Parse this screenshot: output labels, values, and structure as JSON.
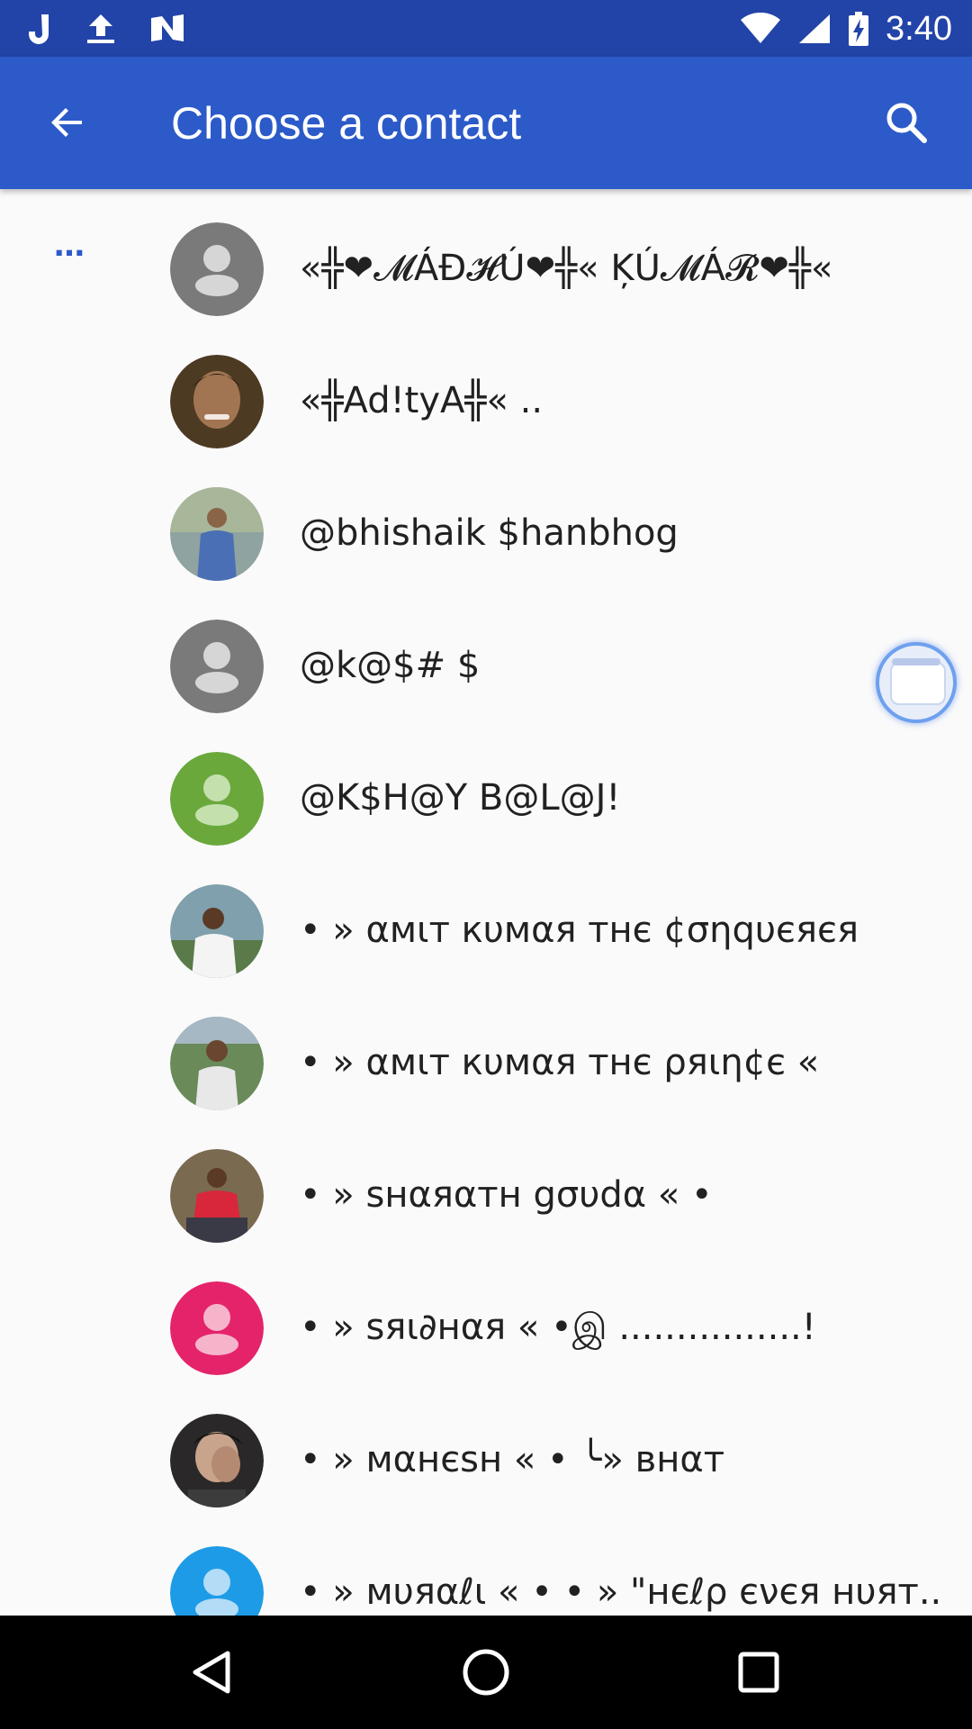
{
  "status_bar": {
    "time": "3:40",
    "left_icons": [
      "j-app-icon",
      "upload-icon",
      "n-app-icon"
    ],
    "right_icons": [
      "wifi-icon",
      "signal-icon",
      "battery-charging-icon"
    ]
  },
  "app_bar": {
    "title": "Choose a contact",
    "back_icon": "arrow-back-icon",
    "search_icon": "search-icon",
    "color": "#2c5ac9"
  },
  "section_header": "…",
  "contacts": [
    {
      "name": "«╬❤𝓜ÁĐ𝓗Ú❤╬« ĶÚ𝓜Á𝓡❤╬«",
      "avatar": "placeholder",
      "avatar_color": "#7a7a7a"
    },
    {
      "name": "«╬Ad!tyA╬« ..",
      "avatar": "photo",
      "avatar_color": "#4d3a22"
    },
    {
      "name": "@bhishaik $hanbhog",
      "avatar": "photo",
      "avatar_color": "#6f8aa6"
    },
    {
      "name": "@k@$# $",
      "avatar": "placeholder",
      "avatar_color": "#7a7a7a"
    },
    {
      "name": "@K$H@Y B@L@J!",
      "avatar": "placeholder",
      "avatar_color": "#6aa83c"
    },
    {
      "name": "• » αмιт кυмαя тнє ¢σηqυєяєя",
      "avatar": "photo",
      "avatar_color": "#5e7f8a"
    },
    {
      "name": "• » αмιт кυмαя тнє ρяιη¢є «",
      "avatar": "photo",
      "avatar_color": "#5f7a55"
    },
    {
      "name": "• » ѕнαяαтн gσυdα « •",
      "avatar": "photo",
      "avatar_color": "#6a5a44"
    },
    {
      "name": "• » ѕяι∂нαя « •இ ................!",
      "avatar": "placeholder",
      "avatar_color": "#e5236b"
    },
    {
      "name": "• » мαнєѕн « • ╰» внαт",
      "avatar": "photo",
      "avatar_color": "#3a3838"
    },
    {
      "name": "• » мυяαℓι « • • » \"нєℓρ єνєя нυят..",
      "avatar": "placeholder",
      "avatar_color": "#1e9be6"
    }
  ],
  "chat_head": {
    "icon": "chat-head-icon"
  },
  "nav_bar": {
    "icons": [
      "back-triangle-icon",
      "home-circle-icon",
      "recents-square-icon"
    ]
  }
}
